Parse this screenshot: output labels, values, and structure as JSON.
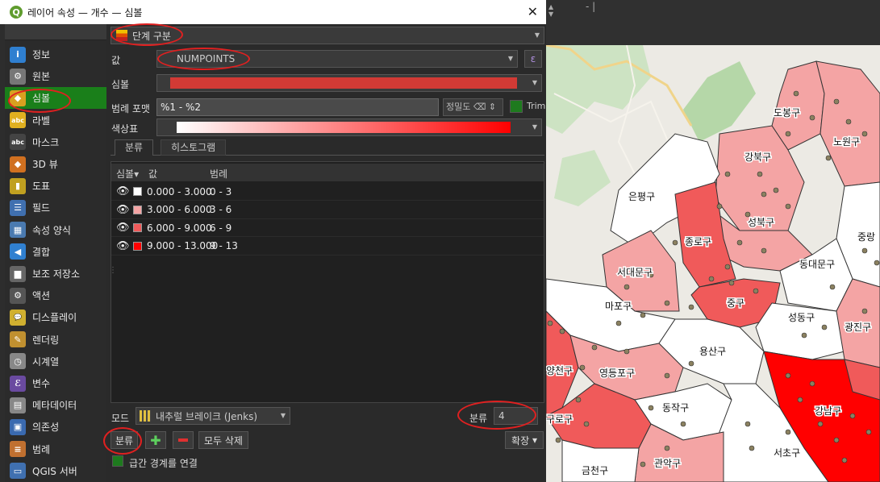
{
  "window": {
    "title": "레이어 속성 — 개수 — 심볼",
    "close_glyph": "✕",
    "logo_letter": "Q"
  },
  "sidebar": {
    "items": [
      {
        "label": "정보",
        "icon": "info-icon",
        "glyph": "i",
        "color": "#2f7fd0"
      },
      {
        "label": "원본",
        "icon": "source-icon",
        "glyph": "⚙",
        "color": "#777777"
      },
      {
        "label": "심볼",
        "icon": "symbology-icon",
        "glyph": "◆",
        "color": "#d8a020"
      },
      {
        "label": "라벨",
        "icon": "label-icon",
        "glyph": "abc",
        "color": "#e0b020"
      },
      {
        "label": "마스크",
        "icon": "mask-icon",
        "glyph": "abc",
        "color": "#444444"
      },
      {
        "label": "3D 뷰",
        "icon": "3d-view-icon",
        "glyph": "◆",
        "color": "#d07020"
      },
      {
        "label": "도표",
        "icon": "diagram-icon",
        "glyph": "▮",
        "color": "#c0a020"
      },
      {
        "label": "필드",
        "icon": "fields-icon",
        "glyph": "☰",
        "color": "#4070b0"
      },
      {
        "label": "속성 양식",
        "icon": "attribute-form-icon",
        "glyph": "▦",
        "color": "#4a7ab0"
      },
      {
        "label": "결합",
        "icon": "join-icon",
        "glyph": "◀",
        "color": "#3080d0"
      },
      {
        "label": "보조 저장소",
        "icon": "auxiliary-storage-icon",
        "glyph": "▆",
        "color": "#666666"
      },
      {
        "label": "액션",
        "icon": "actions-icon",
        "glyph": "⚙",
        "color": "#555555"
      },
      {
        "label": "디스플레이",
        "icon": "display-icon",
        "glyph": "💬",
        "color": "#d0b030"
      },
      {
        "label": "렌더링",
        "icon": "rendering-icon",
        "glyph": "✎",
        "color": "#c09030"
      },
      {
        "label": "시계열",
        "icon": "temporal-icon",
        "glyph": "◷",
        "color": "#888888"
      },
      {
        "label": "변수",
        "icon": "variables-icon",
        "glyph": "ℰ",
        "color": "#6a4aa0"
      },
      {
        "label": "메타데이터",
        "icon": "metadata-icon",
        "glyph": "▤",
        "color": "#888888"
      },
      {
        "label": "의존성",
        "icon": "dependencies-icon",
        "glyph": "▣",
        "color": "#3a6ab0"
      },
      {
        "label": "범례",
        "icon": "legend-icon",
        "glyph": "≡",
        "color": "#c07030"
      },
      {
        "label": "QGIS 서버",
        "icon": "qgis-server-icon",
        "glyph": "▭",
        "color": "#4070b0"
      }
    ],
    "active_index": 2
  },
  "symbology": {
    "renderer": "단계 구분",
    "value_label": "값",
    "value": "NUMPOINTS",
    "expression_glyph": "ε",
    "symbol_label": "심볼",
    "symbol_color": "#d23a35",
    "legend_format_label": "범례 포맷",
    "legend_format": "%1 - %2",
    "precision_label": "정밀도",
    "trim_label": "Trim",
    "color_ramp_label": "색상표",
    "tabs": [
      "분류",
      "히스토그램"
    ],
    "columns": {
      "symbol": "심볼▾",
      "value": "값",
      "legend": "범례"
    },
    "classes": [
      {
        "value": "0.000 - 3.000",
        "legend": "0 - 3",
        "color": "#ffffff"
      },
      {
        "value": "3.000 - 6.000",
        "legend": "3 - 6",
        "color": "#f4a4a4"
      },
      {
        "value": "6.000 - 9.000",
        "legend": "6 - 9",
        "color": "#f05a5a"
      },
      {
        "value": "9.000 - 13.000",
        "legend": "9 - 13",
        "color": "#ff0000"
      }
    ],
    "mode_label": "모드",
    "mode": "내추럴 브레이크 (Jenks)",
    "classes_count_label": "분류",
    "classes_count": "4",
    "classify_button": "분류",
    "delete_all_button": "모두 삭제",
    "advanced_button": "확장",
    "link_boundaries_label": "급간 경계를 연결"
  },
  "map": {
    "districts": [
      "도봉구",
      "노원구",
      "강북구",
      "은평구",
      "성북구",
      "종로구",
      "중랑",
      "서대문구",
      "동대문구",
      "마포구",
      "중구",
      "성동구",
      "광진구",
      "용산구",
      "양천구",
      "영등포구",
      "동작구",
      "강남구",
      "서초구",
      "관악구",
      "금천구",
      "구로구"
    ]
  },
  "colors": {
    "accent_green": "#1a7f1a",
    "annotation_red": "#e02020"
  }
}
